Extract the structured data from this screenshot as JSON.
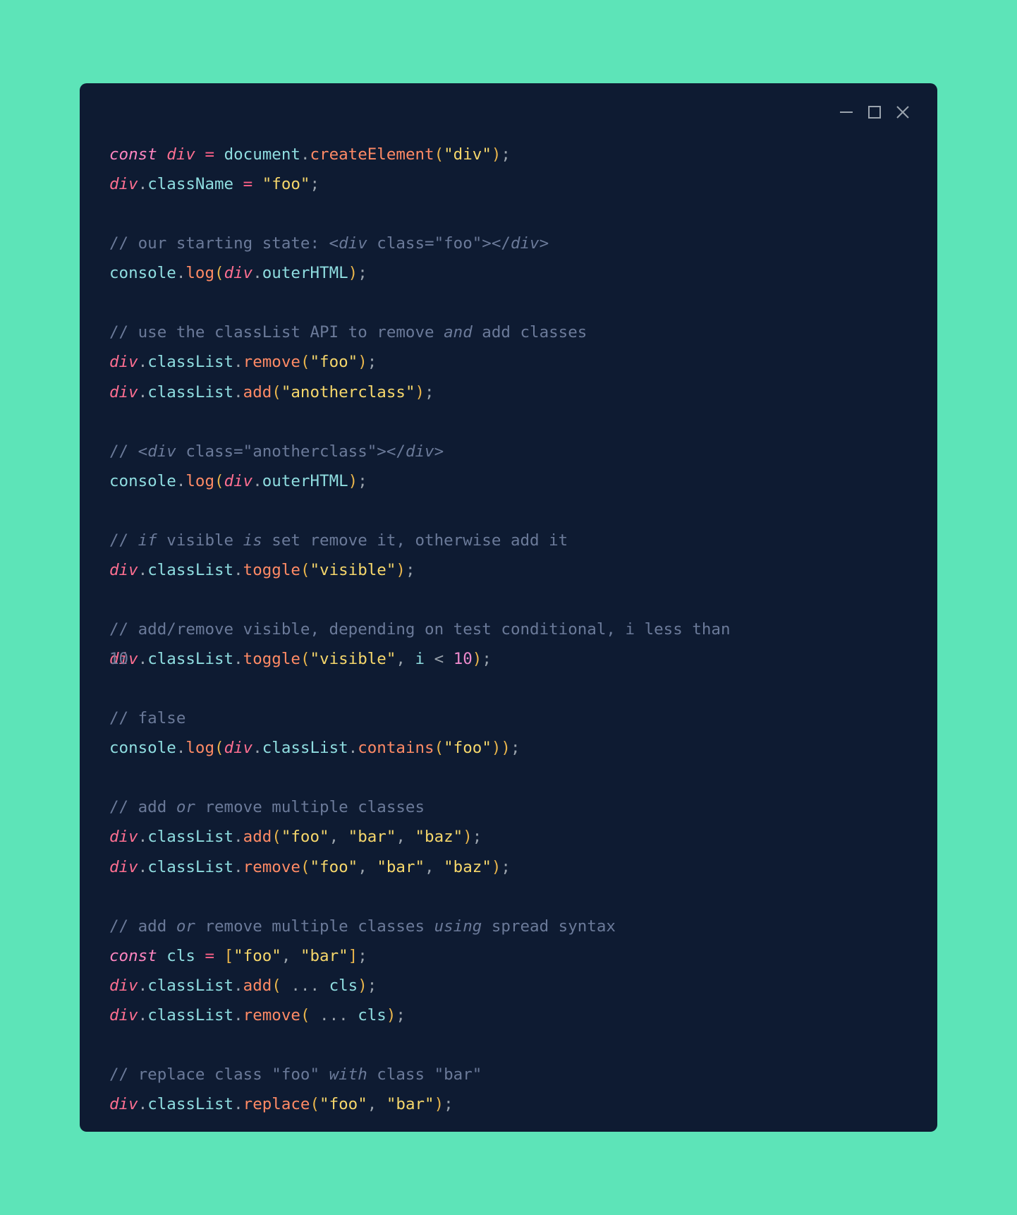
{
  "code": {
    "kw_const": "const",
    "var_div": "div",
    "var_cls": "cls",
    "op_eq": "=",
    "obj_document": "document",
    "obj_console": "console",
    "fn_createElement": "createElement",
    "fn_log": "log",
    "fn_remove": "remove",
    "fn_add": "add",
    "fn_toggle": "toggle",
    "fn_contains": "contains",
    "fn_replace": "replace",
    "prop_className": "className",
    "prop_outerHTML": "outerHTML",
    "prop_classList": "classList",
    "str_div": "\"div\"",
    "str_foo": "\"foo\"",
    "str_anotherclass": "\"anotherclass\"",
    "str_visible": "\"visible\"",
    "str_bar": "\"bar\"",
    "str_baz": "\"baz\"",
    "num_10": "10",
    "ident_i": "i",
    "lt": "<",
    "spread": "...",
    "c1_a": "// our starting state: <",
    "c1_b": " class=\"foo\"></",
    "c1_c": ">",
    "c2_a": "// use the classList API to remove ",
    "c2_and": "and",
    "c2_b": " add classes",
    "c3_a": "// <",
    "c3_b": " class=\"anotherclass\"></",
    "c3_c": ">",
    "c4_a": "// ",
    "c4_if": "if",
    "c4_b": " visible ",
    "c4_is": "is",
    "c4_c": " set remove it, otherwise add it",
    "c5": "// add/remove visible, depending on test conditional, i less than",
    "c5_overlap": "10",
    "c6": "// false",
    "c7_a": "// add ",
    "c7_or": "or",
    "c7_b": " remove multiple classes",
    "c8_a": "// add ",
    "c8_or": "or",
    "c8_b": " remove multiple classes ",
    "c8_using": "using",
    "c8_c": " spread syntax",
    "c9_a": "// replace class \"foo\" ",
    "c9_with": "with",
    "c9_b": " class \"bar\""
  },
  "window_controls": {
    "minimize": "minimize-icon",
    "maximize": "maximize-icon",
    "close": "close-icon"
  }
}
